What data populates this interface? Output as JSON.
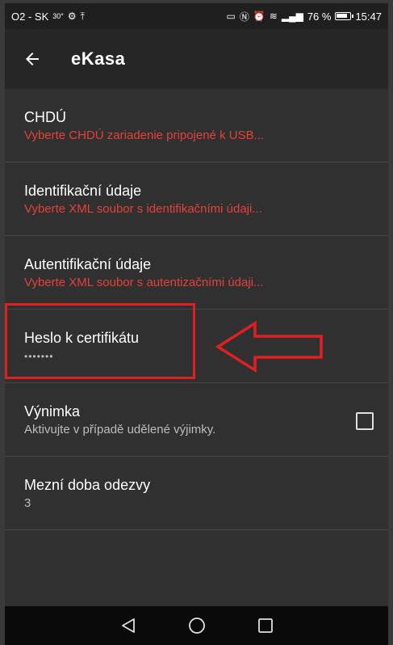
{
  "status_bar": {
    "carrier": "O2 - SK",
    "temperature": "30°",
    "signal_percent": "76 %",
    "time": "15:47"
  },
  "app_bar": {
    "title": "eKasa"
  },
  "settings": [
    {
      "title": "CHDÚ",
      "subtitle": "Vyberte CHDÚ zariadenie pripojené k USB..."
    },
    {
      "title": "Identifikační údaje",
      "subtitle": "Vyberte XML soubor s identifikačními údaji..."
    },
    {
      "title": "Autentifikační údaje",
      "subtitle": "Vyberte XML soubor s autentizačními údaji..."
    },
    {
      "title": "Heslo k certifikátu",
      "subtitle": "•••••••"
    },
    {
      "title": "Výnimka",
      "subtitle": "Aktivujte v případě udělené výjimky.",
      "checked": false
    },
    {
      "title": "Mezní doba odezvy",
      "subtitle": "3"
    }
  ],
  "colors": {
    "accent_red": "#e5403a",
    "highlight": "#e02020"
  },
  "icons": {
    "back": "arrow-left-icon",
    "nav_back": "triangle-back-icon",
    "nav_home": "circle-home-icon",
    "nav_recents": "square-recents-icon"
  }
}
